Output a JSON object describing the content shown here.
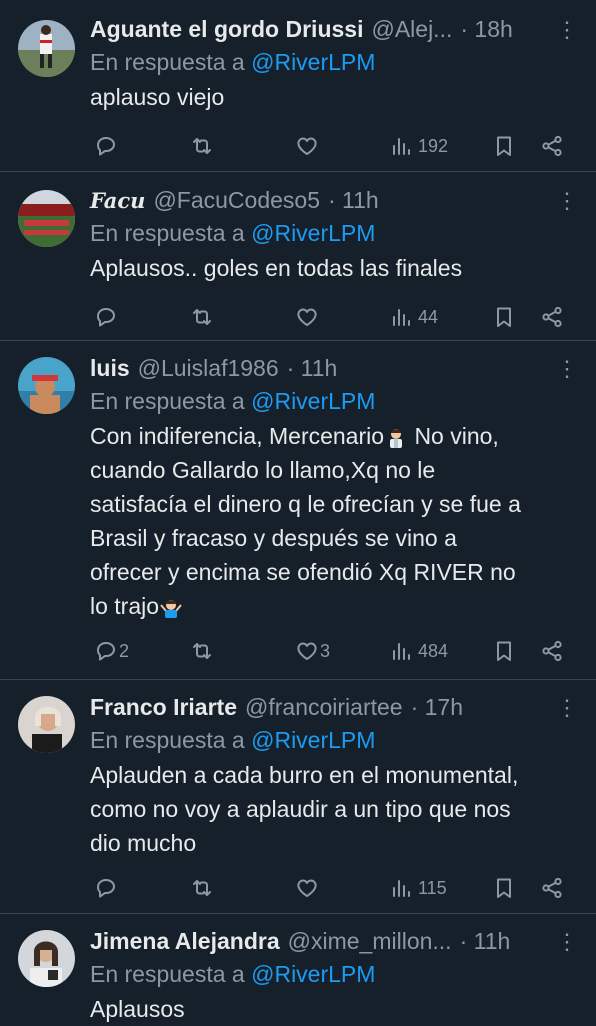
{
  "tweets": [
    {
      "name": "Aguante el gordo Driussi",
      "handle": "@Alej...",
      "time": "· 18h",
      "reply_prefix": "En respuesta a",
      "reply_to": "@RiverLPM",
      "text": "aplauso viejo",
      "replies": "",
      "likes": "",
      "views": "192"
    },
    {
      "name": "Facu",
      "handle": "@FacuCodeso5",
      "time": "· 11h",
      "reply_prefix": "En respuesta a",
      "reply_to": "@RiverLPM",
      "text": "Aplausos.. goles en todas las finales",
      "replies": "",
      "likes": "",
      "views": "44"
    },
    {
      "name": "luis",
      "handle": "@Luislaf1986",
      "time": "· 11h",
      "reply_prefix": "En respuesta a",
      "reply_to": "@RiverLPM",
      "text_lines": [
        "Con indiferencia, Mercenario",
        "No vino,",
        "cuando Gallardo lo llamo,Xq no le",
        "satisfacía el dinero q le ofrecían y se fue a",
        "Brasil y fracaso y después se vino a",
        "ofrecer y encima se ofendió Xq RIVER no",
        "lo trajo"
      ],
      "replies": "2",
      "likes": "3",
      "views": "484"
    },
    {
      "name": "Franco Iriarte",
      "handle": "@francoiriartee",
      "time": "· 17h",
      "reply_prefix": "En respuesta a",
      "reply_to": "@RiverLPM",
      "text": "Aplauden a cada burro en el monumental,\ncomo no voy a aplaudir a un tipo que nos\ndio mucho",
      "replies": "",
      "likes": "",
      "views": "115"
    },
    {
      "name": "Jimena Alejandra",
      "handle": "@xime_millon...",
      "time": "· 11h",
      "reply_prefix": "En respuesta a",
      "reply_to": "@RiverLPM",
      "text": "Aplausos"
    }
  ],
  "colors": {
    "background": "#15202b",
    "link": "#1d9bf0",
    "muted": "#8b98a5",
    "text": "#e7e9ea"
  },
  "icons": [
    "reply-icon",
    "retweet-icon",
    "like-icon",
    "views-icon",
    "bookmark-icon",
    "share-icon",
    "more-icon"
  ]
}
